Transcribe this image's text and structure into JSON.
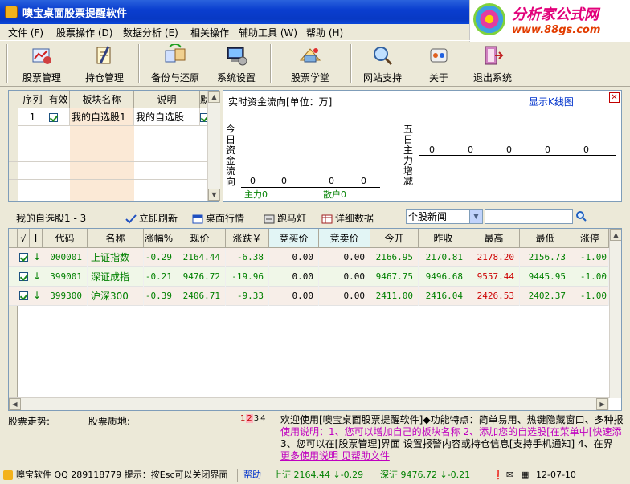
{
  "window": {
    "title": "噢宝桌面股票提醒软件",
    "brand": {
      "name": "分析家公式网",
      "url": "www.88gs.com"
    }
  },
  "menu": [
    {
      "label": "文件 (F)"
    },
    {
      "label": "股票操作 (D)"
    },
    {
      "label": "数据分析 (E)"
    },
    {
      "label": "相关操作"
    },
    {
      "label": "辅助工具 (W)"
    },
    {
      "label": "帮助 (H)"
    }
  ],
  "toolbar": [
    {
      "label": "股票管理",
      "icon": "stock-manage-icon"
    },
    {
      "label": "持仓管理",
      "icon": "position-manage-icon"
    },
    {
      "label": "备份与还原",
      "icon": "backup-icon"
    },
    {
      "label": "系统设置",
      "icon": "settings-icon"
    },
    {
      "label": "股票学堂",
      "icon": "school-icon"
    },
    {
      "label": "网站支持",
      "icon": "web-support-icon"
    },
    {
      "label": "关于",
      "icon": "about-icon"
    },
    {
      "label": "退出系统",
      "icon": "exit-icon"
    }
  ],
  "block_grid": {
    "headers": [
      "序列",
      "有效",
      "板块名称",
      "说明",
      "默"
    ],
    "rows": [
      {
        "seq": "1",
        "valid": true,
        "name": "我的自选股1",
        "desc": "我的自选股",
        "default": true
      }
    ]
  },
  "flow_panel": {
    "title": "实时资金流向[单位：万]",
    "kline_link": "显示K线图",
    "today_label": "今日资金流向",
    "today_values": [
      "0",
      "0",
      "0",
      "0"
    ],
    "main_force": "主力0",
    "retail": "散户0",
    "five_day_label": "五日主力增减",
    "five_day_values": [
      "0",
      "0",
      "0",
      "0",
      "0"
    ]
  },
  "list_bar": {
    "group": "我的自选股1 - 3",
    "refresh": "立即刷新",
    "desktop": "桌面行情",
    "marquee": "跑马灯",
    "detail": "详细数据",
    "news_select": "个股新闻",
    "search_value": ""
  },
  "stock_table": {
    "headers": [
      "√",
      "I",
      "代码",
      "名称",
      "涨幅%",
      "现价",
      "涨跌￥",
      "竞买价",
      "竞卖价",
      "今开",
      "昨收",
      "最高",
      "最低",
      "涨停"
    ],
    "rows": [
      {
        "code": "000001",
        "name": "上证指数",
        "pct": "-0.29",
        "price": "2164.44",
        "chg": "-6.38",
        "bid": "0.00",
        "ask": "0.00",
        "open": "2166.95",
        "prev": "2170.81",
        "high": "2178.20",
        "low": "2156.73",
        "limit": "-1.00"
      },
      {
        "code": "399001",
        "name": "深证成指",
        "pct": "-0.21",
        "price": "9476.72",
        "chg": "-19.96",
        "bid": "0.00",
        "ask": "0.00",
        "open": "9467.75",
        "prev": "9496.68",
        "high": "9557.44",
        "low": "9445.95",
        "limit": "-1.00"
      },
      {
        "code": "399300",
        "name": "沪深300",
        "pct": "-0.39",
        "price": "2406.71",
        "chg": "-9.33",
        "bid": "0.00",
        "ask": "0.00",
        "open": "2411.00",
        "prev": "2416.04",
        "high": "2426.53",
        "low": "2402.37",
        "limit": "-1.00"
      }
    ]
  },
  "bottom": {
    "trend_label": "股票走势:",
    "quality_label": "股票质地:",
    "pages": [
      "1",
      "2",
      "3",
      "4"
    ],
    "notice_line1": "欢迎使用[噢宝桌面股票提醒软件]◆功能特点：简单易用、热键隐藏窗口、多种报",
    "notice_line2": "使用说明：1、您可以增加自己的板块名称    2、添加您的自选股[在菜单中[快速添",
    "notice_line3": "3、您可以在[股票管理]界面 设置报警内容或持仓信息[支持手机通知]   4、在界",
    "notice_line4": "更多使用说明 见帮助文件"
  },
  "status": {
    "company": "噢宝软件 QQ 289118779 提示：按Esc可以关闭界面",
    "help": "帮助",
    "sh": "上证 2164.44 ↓-0.29",
    "sz": "深证 9476.72 ↓-0.21",
    "date": "12-07-10"
  }
}
